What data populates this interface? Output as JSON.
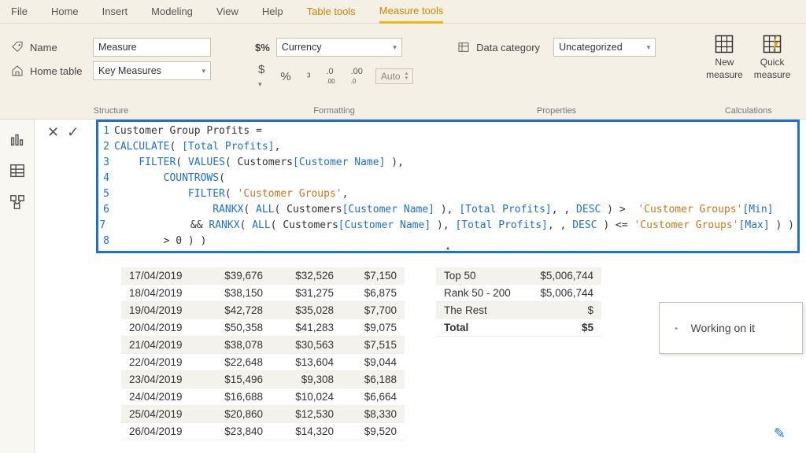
{
  "tabs": {
    "file": "File",
    "home": "Home",
    "insert": "Insert",
    "modeling": "Modeling",
    "view": "View",
    "help": "Help",
    "table_tools": "Table tools",
    "measure_tools": "Measure tools"
  },
  "ribbon": {
    "structure": {
      "name_label": "Name",
      "name_value": "Measure",
      "home_table_label": "Home table",
      "home_table_value": "Key Measures",
      "group_title": "Structure"
    },
    "formatting": {
      "format_prefix": "$%",
      "format_value": "Currency",
      "auto_value": "Auto",
      "group_title": "Formatting"
    },
    "properties": {
      "category_label": "Data category",
      "category_value": "Uncategorized",
      "group_title": "Properties"
    },
    "calculations": {
      "new_label1": "New",
      "new_label2": "measure",
      "quick_label1": "Quick",
      "quick_label2": "measure",
      "group_title": "Calculations"
    }
  },
  "formula": {
    "lines": [
      "Customer Group Profits =",
      "CALCULATE( [Total Profits],",
      "    FILTER( VALUES( Customers[Customer Name] ),",
      "        COUNTROWS(",
      "            FILTER( 'Customer Groups',",
      "                RANKX( ALL( Customers[Customer Name] ), [Total Profits], , DESC ) >  'Customer Groups'[Min]",
      "             && RANKX( ALL( Customers[Customer Name] ), [Total Profits], , DESC ) <= 'Customer Groups'[Max] ) )",
      "        > 0 ) )"
    ]
  },
  "grid_left": {
    "rows": [
      {
        "date": "17/04/2019",
        "c1": "$39,676",
        "c2": "$32,526",
        "c3": "$7,150"
      },
      {
        "date": "18/04/2019",
        "c1": "$38,150",
        "c2": "$31,275",
        "c3": "$6,875"
      },
      {
        "date": "19/04/2019",
        "c1": "$42,728",
        "c2": "$35,028",
        "c3": "$7,700"
      },
      {
        "date": "20/04/2019",
        "c1": "$50,358",
        "c2": "$41,283",
        "c3": "$9,075"
      },
      {
        "date": "21/04/2019",
        "c1": "$38,078",
        "c2": "$30,563",
        "c3": "$7,515"
      },
      {
        "date": "22/04/2019",
        "c1": "$22,648",
        "c2": "$13,604",
        "c3": "$9,044"
      },
      {
        "date": "23/04/2019",
        "c1": "$15,496",
        "c2": "$9,308",
        "c3": "$6,188"
      },
      {
        "date": "24/04/2019",
        "c1": "$16,688",
        "c2": "$10,024",
        "c3": "$6,664"
      },
      {
        "date": "25/04/2019",
        "c1": "$20,860",
        "c2": "$12,530",
        "c3": "$8,330"
      },
      {
        "date": "26/04/2019",
        "c1": "$23,840",
        "c2": "$14,320",
        "c3": "$9,520"
      }
    ]
  },
  "grid_right": {
    "rows": [
      {
        "label": "Top 50",
        "val": "$5,006,744",
        "bold": false
      },
      {
        "label": "Rank 50 - 200",
        "val": "$5,006,744",
        "bold": false
      },
      {
        "label": "The Rest",
        "val": "$",
        "bold": false
      },
      {
        "label": "Total",
        "val": "$5",
        "bold": true
      }
    ]
  },
  "tooltip": {
    "text": "Working on it"
  }
}
